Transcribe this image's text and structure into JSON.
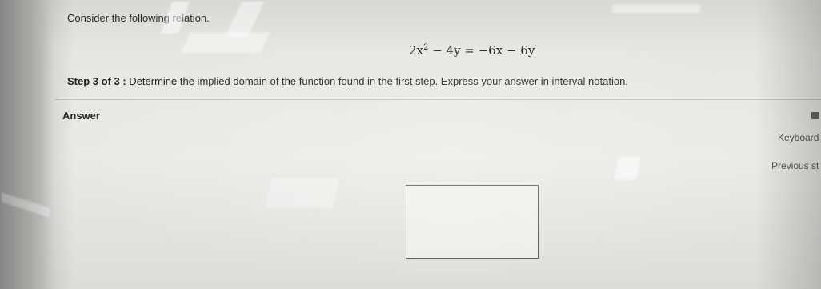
{
  "question": {
    "intro": "Consider the following relation.",
    "equation": {
      "lhs_a": "2x",
      "lhs_exp": "2",
      "lhs_b": " − 4y = −6x − 6y"
    },
    "step_label": "Step 3 of 3 :",
    "step_text": " Determine the implied domain of the function found in the first step. Express your answer in interval notation."
  },
  "answer": {
    "label": "Answer",
    "input_value": ""
  },
  "side_panel": {
    "keyboard_label": "Keyboard",
    "previous_label": "Previous st",
    "keyboard_icon": "keyboard-icon"
  }
}
